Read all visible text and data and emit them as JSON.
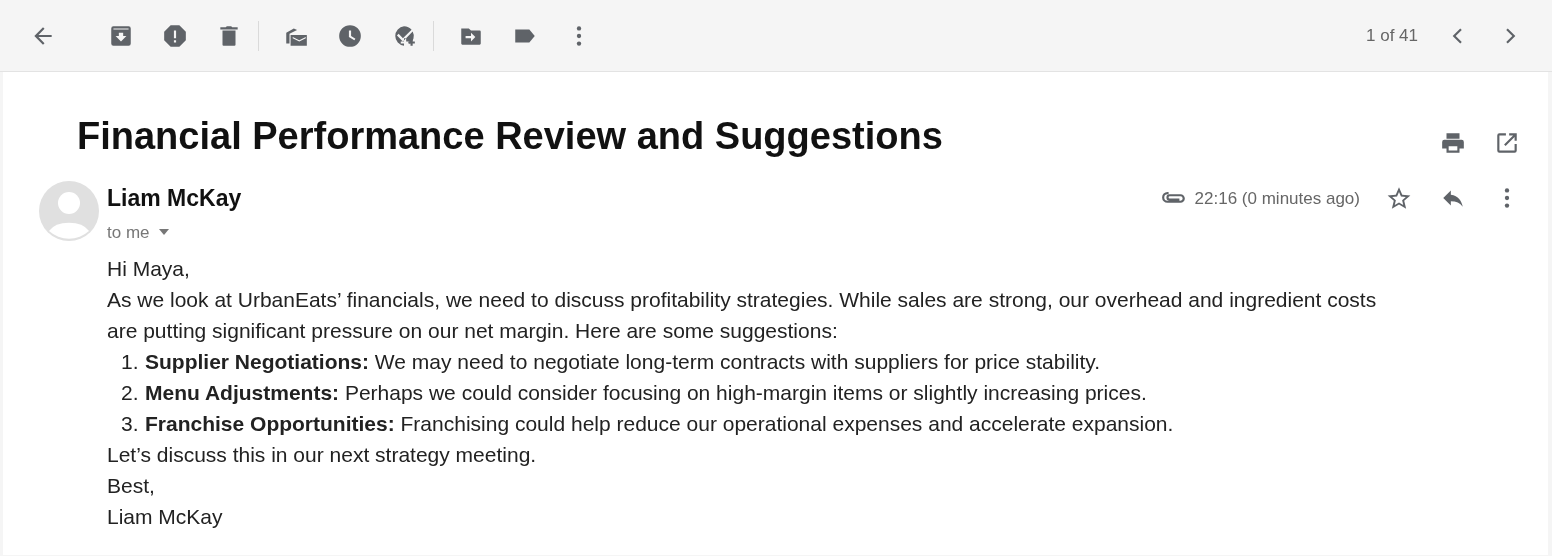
{
  "toolbar": {
    "pagination": "1 of 41"
  },
  "email": {
    "subject": "Financial Performance Review and Suggestions",
    "sender": "Liam McKay",
    "recipient": "to me",
    "time": "22:16 (0 minutes ago)",
    "has_attachment": true,
    "starred": false,
    "body": [
      {
        "kind": "para",
        "text": "Hi Maya,"
      },
      {
        "kind": "para",
        "text": "As we look at UrbanEats’ financials, we need to discuss profitability strategies. While sales are strong, our overhead and ingredient costs are putting significant pressure on our net margin. Here are some suggestions:"
      },
      {
        "kind": "list",
        "items": [
          {
            "marker": "1.",
            "text": "**Supplier Negotiations:** We may need to negotiate long-term contracts with suppliers for price stability."
          },
          {
            "marker": "2.",
            "text": "**Menu Adjustments:** Perhaps we could consider focusing on high-margin items or slightly increasing prices."
          },
          {
            "marker": "3.",
            "text": "**Franchise Opportunities:** Franchising could help reduce our operational expenses and accelerate expansion."
          }
        ]
      },
      {
        "kind": "para",
        "text": "Let’s discuss this in our next strategy meeting."
      },
      {
        "kind": "para",
        "text": "Best,"
      },
      {
        "kind": "para",
        "text": "Liam McKay"
      }
    ]
  }
}
